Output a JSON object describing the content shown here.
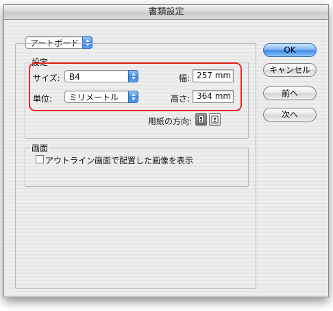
{
  "window": {
    "title": "書類設定"
  },
  "mode_popup": {
    "value": "アートボード"
  },
  "settings_group": {
    "label": "設定",
    "size_label": "サイズ:",
    "size_value": "B4",
    "unit_label": "単位:",
    "unit_value": "ミリメートル",
    "width_label": "幅:",
    "width_value": "257 mm",
    "height_label": "高さ:",
    "height_value": "364 mm",
    "orientation_label": "用紙の方向:",
    "orientation_selected": "portrait"
  },
  "display_group": {
    "label": "画面",
    "checkbox_label": "アウトライン画面で配置した画像を表示",
    "checkbox_checked": false
  },
  "buttons": {
    "ok": "OK",
    "cancel": "キャンセル",
    "prev": "前へ",
    "next": "次へ"
  },
  "colors": {
    "highlight": "#e8261b",
    "accent": "#3f8ae7"
  }
}
